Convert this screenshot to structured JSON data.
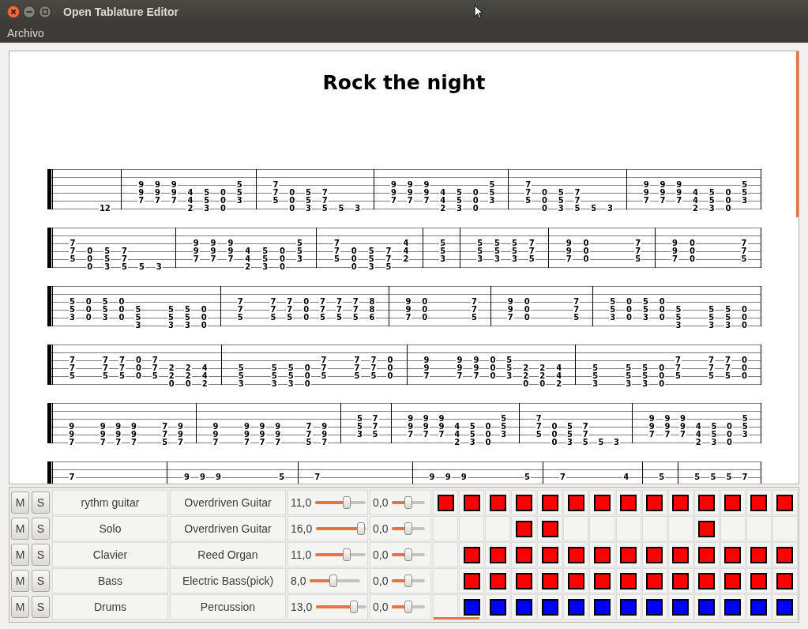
{
  "window": {
    "title": "Open Tablature Editor"
  },
  "menu": [
    {
      "label": "Archivo"
    }
  ],
  "score": {
    "title": "Rock the night",
    "systems": [
      {
        "measures": [
          {
            "beats": [
              {
                "kind": "blank"
              },
              {
                "kind": "blank"
              },
              {
                "kind": "notes",
                "string_6": "12"
              }
            ]
          },
          {
            "beats": [
              {
                "kind": "notes",
                "string_3": "9",
                "string_4": "9",
                "string_5": "7"
              },
              {
                "kind": "notes",
                "string_3": "9",
                "string_4": "9",
                "string_5": "7"
              },
              {
                "kind": "notes",
                "string_3": "9",
                "string_4": "9",
                "string_5": "7"
              },
              {
                "kind": "notes",
                "string_4": "4",
                "string_5": "4",
                "string_6": "2"
              },
              {
                "kind": "notes",
                "string_4": "5",
                "string_5": "5",
                "string_6": "3"
              },
              {
                "kind": "notes",
                "string_4": "0",
                "string_5": "0",
                "string_6": "0"
              },
              {
                "kind": "notes",
                "string_3": "5",
                "string_4": "5",
                "string_5": "3"
              }
            ]
          },
          {
            "beats": [
              {
                "kind": "notes",
                "string_3": "7",
                "string_4": "7",
                "string_5": "5"
              },
              {
                "kind": "notes",
                "string_4": "0",
                "string_5": "0",
                "string_6": "0"
              },
              {
                "kind": "notes",
                "string_4": "5",
                "string_5": "5",
                "string_6": "3"
              },
              {
                "kind": "notes",
                "string_4": "7",
                "string_5": "7",
                "string_6": "5"
              },
              {
                "kind": "notes",
                "string_6": "5"
              },
              {
                "kind": "notes",
                "string_6": "3"
              }
            ]
          },
          {
            "beats": [
              {
                "kind": "notes",
                "string_3": "9",
                "string_4": "9",
                "string_5": "7"
              },
              {
                "kind": "notes",
                "string_3": "9",
                "string_4": "9",
                "string_5": "7"
              },
              {
                "kind": "notes",
                "string_3": "9",
                "string_4": "9",
                "string_5": "7"
              },
              {
                "kind": "notes",
                "string_4": "4",
                "string_5": "4",
                "string_6": "2"
              },
              {
                "kind": "notes",
                "string_4": "5",
                "string_5": "5",
                "string_6": "3"
              },
              {
                "kind": "notes",
                "string_4": "0",
                "string_5": "0",
                "string_6": "0"
              },
              {
                "kind": "notes",
                "string_3": "5",
                "string_4": "5",
                "string_5": "3"
              }
            ]
          },
          {
            "beats": [
              {
                "kind": "notes",
                "string_3": "7",
                "string_4": "7",
                "string_5": "5"
              },
              {
                "kind": "notes",
                "string_4": "0",
                "string_5": "0",
                "string_6": "0"
              },
              {
                "kind": "notes",
                "string_4": "5",
                "string_5": "5",
                "string_6": "3"
              },
              {
                "kind": "notes",
                "string_4": "7",
                "string_5": "7",
                "string_6": "5"
              },
              {
                "kind": "notes",
                "string_6": "5"
              },
              {
                "kind": "notes",
                "string_6": "3"
              }
            ]
          },
          {
            "beats": [
              {
                "kind": "notes",
                "string_3": "9",
                "string_4": "9",
                "string_5": "7"
              },
              {
                "kind": "notes",
                "string_3": "9",
                "string_4": "9",
                "string_5": "7"
              },
              {
                "kind": "notes",
                "string_3": "9",
                "string_4": "9",
                "string_5": "7"
              },
              {
                "kind": "notes",
                "string_4": "4",
                "string_5": "4",
                "string_6": "2"
              },
              {
                "kind": "notes",
                "string_4": "5",
                "string_5": "5",
                "string_6": "3"
              },
              {
                "kind": "notes",
                "string_4": "0",
                "string_5": "0",
                "string_6": "0"
              },
              {
                "kind": "notes",
                "string_3": "5",
                "string_4": "5",
                "string_5": "3"
              }
            ]
          }
        ]
      },
      {
        "measures": [
          {
            "beats": [
              {
                "kind": "notes",
                "string_3": "7",
                "string_4": "7",
                "string_5": "5"
              },
              {
                "kind": "notes",
                "string_4": "0",
                "string_5": "0",
                "string_6": "0"
              },
              {
                "kind": "notes",
                "string_4": "5",
                "string_5": "5",
                "string_6": "3"
              },
              {
                "kind": "notes",
                "string_4": "7",
                "string_5": "7",
                "string_6": "5"
              },
              {
                "kind": "notes",
                "string_6": "5"
              },
              {
                "kind": "notes",
                "string_6": "3"
              }
            ]
          },
          {
            "beats": [
              {
                "kind": "notes",
                "string_3": "9",
                "string_4": "9",
                "string_5": "7"
              },
              {
                "kind": "notes",
                "string_3": "9",
                "string_4": "9",
                "string_5": "7"
              },
              {
                "kind": "notes",
                "string_3": "9",
                "string_4": "9",
                "string_5": "7"
              },
              {
                "kind": "notes",
                "string_4": "4",
                "string_5": "4",
                "string_6": "2"
              },
              {
                "kind": "notes",
                "string_4": "5",
                "string_5": "5",
                "string_6": "3"
              },
              {
                "kind": "notes",
                "string_4": "0",
                "string_5": "0",
                "string_6": "0"
              },
              {
                "kind": "notes",
                "string_3": "5",
                "string_4": "5",
                "string_5": "3"
              }
            ]
          },
          {
            "beats": [
              {
                "kind": "notes",
                "string_3": "7",
                "string_4": "7",
                "string_5": "5"
              },
              {
                "kind": "notes",
                "string_4": "0",
                "string_5": "0",
                "string_6": "0"
              },
              {
                "kind": "notes",
                "string_4": "5",
                "string_5": "5",
                "string_6": "3"
              },
              {
                "kind": "notes",
                "string_4": "7",
                "string_5": "7",
                "string_6": "5"
              },
              {
                "kind": "notes",
                "string_3": "4",
                "string_4": "4",
                "string_5": "2"
              }
            ]
          },
          {
            "beats": [
              {
                "kind": "notes",
                "string_3": "5",
                "string_4": "5",
                "string_5": "3"
              }
            ]
          },
          {
            "beats": [
              {
                "kind": "notes",
                "string_3": "5",
                "string_4": "5",
                "string_5": "3"
              },
              {
                "kind": "notes",
                "string_3": "5",
                "string_4": "5",
                "string_5": "3"
              },
              {
                "kind": "notes",
                "string_3": "5",
                "string_4": "5",
                "string_5": "3"
              },
              {
                "kind": "notes",
                "string_3": "7",
                "string_4": "7",
                "string_5": "5"
              }
            ]
          },
          {
            "beats": [
              {
                "kind": "notes",
                "string_3": "9",
                "string_4": "9",
                "string_5": "7"
              },
              {
                "kind": "notes",
                "string_3": "0",
                "string_4": "0",
                "string_5": "0"
              },
              {
                "kind": "blank"
              },
              {
                "kind": "blank"
              },
              {
                "kind": "notes",
                "string_3": "7",
                "string_4": "7",
                "string_5": "5"
              }
            ]
          },
          {
            "beats": [
              {
                "kind": "notes",
                "string_3": "9",
                "string_4": "9",
                "string_5": "7"
              },
              {
                "kind": "notes",
                "string_3": "0",
                "string_4": "0",
                "string_5": "0"
              },
              {
                "kind": "blank"
              },
              {
                "kind": "blank"
              },
              {
                "kind": "notes",
                "string_3": "7",
                "string_4": "7",
                "string_5": "5"
              }
            ]
          }
        ]
      },
      {
        "measures": [
          {
            "beats": [
              {
                "kind": "notes",
                "string_3": "5",
                "string_4": "5",
                "string_5": "3"
              },
              {
                "kind": "notes",
                "string_3": "0",
                "string_4": "0",
                "string_5": "0"
              },
              {
                "kind": "notes",
                "string_3": "5",
                "string_4": "5",
                "string_5": "3"
              },
              {
                "kind": "notes",
                "string_3": "0",
                "string_4": "0",
                "string_5": "0"
              },
              {
                "kind": "notes",
                "string_4": "5",
                "string_5": "5",
                "string_6": "3"
              },
              {
                "kind": "blank"
              },
              {
                "kind": "notes",
                "string_4": "5",
                "string_5": "5",
                "string_6": "3"
              },
              {
                "kind": "notes",
                "string_4": "5",
                "string_5": "5",
                "string_6": "3"
              },
              {
                "kind": "notes",
                "string_4": "0",
                "string_5": "0",
                "string_6": "0"
              }
            ]
          },
          {
            "beats": [
              {
                "kind": "notes",
                "string_3": "7",
                "string_4": "7",
                "string_5": "5"
              },
              {
                "kind": "blank"
              },
              {
                "kind": "notes",
                "string_3": "7",
                "string_4": "7",
                "string_5": "5"
              },
              {
                "kind": "notes",
                "string_3": "7",
                "string_4": "7",
                "string_5": "5"
              },
              {
                "kind": "notes",
                "string_3": "0",
                "string_4": "0",
                "string_5": "0"
              },
              {
                "kind": "notes",
                "string_3": "7",
                "string_4": "7",
                "string_5": "5"
              },
              {
                "kind": "notes",
                "string_3": "7",
                "string_4": "7",
                "string_5": "5"
              },
              {
                "kind": "notes",
                "string_3": "7",
                "string_4": "7",
                "string_5": "5"
              },
              {
                "kind": "notes",
                "string_3": "8",
                "string_4": "8",
                "string_5": "6"
              }
            ]
          },
          {
            "beats": [
              {
                "kind": "notes",
                "string_3": "9",
                "string_4": "9",
                "string_5": "7"
              },
              {
                "kind": "notes",
                "string_3": "0",
                "string_4": "0",
                "string_5": "0"
              },
              {
                "kind": "blank"
              },
              {
                "kind": "blank"
              },
              {
                "kind": "notes",
                "string_3": "7",
                "string_4": "7",
                "string_5": "5"
              }
            ]
          },
          {
            "beats": [
              {
                "kind": "notes",
                "string_3": "9",
                "string_4": "9",
                "string_5": "7"
              },
              {
                "kind": "notes",
                "string_3": "0",
                "string_4": "0",
                "string_5": "0"
              },
              {
                "kind": "blank"
              },
              {
                "kind": "blank"
              },
              {
                "kind": "notes",
                "string_3": "7",
                "string_4": "7",
                "string_5": "5"
              }
            ]
          },
          {
            "beats": [
              {
                "kind": "notes",
                "string_3": "5",
                "string_4": "5",
                "string_5": "3"
              },
              {
                "kind": "notes",
                "string_3": "0",
                "string_4": "0",
                "string_5": "0"
              },
              {
                "kind": "notes",
                "string_3": "5",
                "string_4": "5",
                "string_5": "3"
              },
              {
                "kind": "notes",
                "string_3": "0",
                "string_4": "0",
                "string_5": "0"
              },
              {
                "kind": "notes",
                "string_4": "5",
                "string_5": "5",
                "string_6": "3"
              },
              {
                "kind": "blank"
              },
              {
                "kind": "notes",
                "string_4": "5",
                "string_5": "5",
                "string_6": "3"
              },
              {
                "kind": "notes",
                "string_4": "5",
                "string_5": "5",
                "string_6": "3"
              },
              {
                "kind": "notes",
                "string_4": "0",
                "string_5": "0",
                "string_6": "0"
              }
            ]
          }
        ]
      },
      {
        "measures": [
          {
            "beats": [
              {
                "kind": "notes",
                "string_3": "7",
                "string_4": "7",
                "string_5": "5"
              },
              {
                "kind": "blank"
              },
              {
                "kind": "notes",
                "string_3": "7",
                "string_4": "7",
                "string_5": "5"
              },
              {
                "kind": "notes",
                "string_3": "7",
                "string_4": "7",
                "string_5": "5"
              },
              {
                "kind": "notes",
                "string_3": "0",
                "string_4": "0",
                "string_5": "0"
              },
              {
                "kind": "notes",
                "string_3": "7",
                "string_4": "7",
                "string_5": "5"
              },
              {
                "kind": "notes",
                "string_4": "2",
                "string_5": "2",
                "string_6": "0"
              },
              {
                "kind": "notes",
                "string_4": "2",
                "string_5": "2",
                "string_6": "0"
              },
              {
                "kind": "notes",
                "string_4": "4",
                "string_5": "4",
                "string_6": "2"
              }
            ]
          },
          {
            "beats": [
              {
                "kind": "notes",
                "string_4": "5",
                "string_5": "5",
                "string_6": "3"
              },
              {
                "kind": "blank"
              },
              {
                "kind": "notes",
                "string_4": "5",
                "string_5": "5",
                "string_6": "3"
              },
              {
                "kind": "notes",
                "string_4": "5",
                "string_5": "5",
                "string_6": "3"
              },
              {
                "kind": "notes",
                "string_4": "0",
                "string_5": "0",
                "string_6": "0"
              },
              {
                "kind": "notes",
                "string_3": "7",
                "string_4": "7",
                "string_5": "5"
              },
              {
                "kind": "blank"
              },
              {
                "kind": "notes",
                "string_3": "7",
                "string_4": "7",
                "string_5": "5"
              },
              {
                "kind": "notes",
                "string_3": "7",
                "string_4": "7",
                "string_5": "5"
              },
              {
                "kind": "notes",
                "string_3": "0",
                "string_4": "0",
                "string_5": "0"
              }
            ]
          },
          {
            "beats": [
              {
                "kind": "notes",
                "string_3": "9",
                "string_4": "9",
                "string_5": "7"
              },
              {
                "kind": "blank"
              },
              {
                "kind": "notes",
                "string_3": "9",
                "string_4": "9",
                "string_5": "7"
              },
              {
                "kind": "notes",
                "string_3": "9",
                "string_4": "9",
                "string_5": "7"
              },
              {
                "kind": "notes",
                "string_3": "0",
                "string_4": "0",
                "string_5": "0"
              },
              {
                "kind": "notes",
                "string_3": "5",
                "string_4": "5",
                "string_5": "3"
              },
              {
                "kind": "notes",
                "string_4": "2",
                "string_5": "2",
                "string_6": "0"
              },
              {
                "kind": "notes",
                "string_4": "2",
                "string_5": "2",
                "string_6": "0"
              },
              {
                "kind": "notes",
                "string_4": "4",
                "string_5": "4",
                "string_6": "2"
              }
            ]
          },
          {
            "beats": [
              {
                "kind": "notes",
                "string_4": "5",
                "string_5": "5",
                "string_6": "3"
              },
              {
                "kind": "blank"
              },
              {
                "kind": "notes",
                "string_4": "5",
                "string_5": "5",
                "string_6": "3"
              },
              {
                "kind": "notes",
                "string_4": "5",
                "string_5": "5",
                "string_6": "3"
              },
              {
                "kind": "notes",
                "string_4": "0",
                "string_5": "0",
                "string_6": "0"
              },
              {
                "kind": "notes",
                "string_3": "7",
                "string_4": "7",
                "string_5": "5"
              },
              {
                "kind": "blank"
              },
              {
                "kind": "notes",
                "string_3": "7",
                "string_4": "7",
                "string_5": "5"
              },
              {
                "kind": "notes",
                "string_3": "7",
                "string_4": "7",
                "string_5": "5"
              },
              {
                "kind": "notes",
                "string_3": "0",
                "string_4": "0",
                "string_5": "0"
              }
            ]
          }
        ]
      },
      {
        "measures": [
          {
            "beats": [
              {
                "kind": "notes",
                "string_4": "9",
                "string_5": "9",
                "string_6": "7"
              },
              {
                "kind": "blank"
              },
              {
                "kind": "notes",
                "string_4": "9",
                "string_5": "9",
                "string_6": "7"
              },
              {
                "kind": "notes",
                "string_4": "9",
                "string_5": "9",
                "string_6": "7"
              },
              {
                "kind": "notes",
                "string_4": "9",
                "string_5": "9",
                "string_6": "7"
              },
              {
                "kind": "blank"
              },
              {
                "kind": "notes",
                "string_4": "7",
                "string_5": "7",
                "string_6": "5"
              },
              {
                "kind": "notes",
                "string_4": "9",
                "string_5": "9",
                "string_6": "7"
              }
            ]
          },
          {
            "beats": [
              {
                "kind": "notes",
                "string_4": "9",
                "string_5": "9",
                "string_6": "7"
              },
              {
                "kind": "blank"
              },
              {
                "kind": "notes",
                "string_4": "9",
                "string_5": "9",
                "string_6": "7"
              },
              {
                "kind": "notes",
                "string_4": "9",
                "string_5": "9",
                "string_6": "7"
              },
              {
                "kind": "notes",
                "string_4": "9",
                "string_5": "9",
                "string_6": "7"
              },
              {
                "kind": "blank"
              },
              {
                "kind": "notes",
                "string_4": "7",
                "string_5": "7",
                "string_6": "5"
              },
              {
                "kind": "notes",
                "string_4": "9",
                "string_5": "9",
                "string_6": "7"
              }
            ]
          },
          {
            "beats": [
              {
                "kind": "notes",
                "string_3": "5",
                "string_4": "5",
                "string_5": "3"
              },
              {
                "kind": "notes",
                "string_3": "7",
                "string_4": "7",
                "string_5": "5"
              }
            ]
          },
          {
            "beats": [
              {
                "kind": "notes",
                "string_3": "9",
                "string_4": "9",
                "string_5": "7"
              },
              {
                "kind": "notes",
                "string_3": "9",
                "string_4": "9",
                "string_5": "7"
              },
              {
                "kind": "notes",
                "string_3": "9",
                "string_4": "9",
                "string_5": "7"
              },
              {
                "kind": "notes",
                "string_4": "4",
                "string_5": "4",
                "string_6": "2"
              },
              {
                "kind": "notes",
                "string_4": "5",
                "string_5": "5",
                "string_6": "3"
              },
              {
                "kind": "notes",
                "string_4": "0",
                "string_5": "0",
                "string_6": "0"
              },
              {
                "kind": "notes",
                "string_3": "5",
                "string_4": "5",
                "string_5": "3"
              }
            ]
          },
          {
            "beats": [
              {
                "kind": "notes",
                "string_3": "7",
                "string_4": "7",
                "string_5": "5"
              },
              {
                "kind": "notes",
                "string_4": "0",
                "string_5": "0",
                "string_6": "0"
              },
              {
                "kind": "notes",
                "string_4": "5",
                "string_5": "5",
                "string_6": "3"
              },
              {
                "kind": "notes",
                "string_4": "7",
                "string_5": "7",
                "string_6": "5"
              },
              {
                "kind": "notes",
                "string_6": "5"
              },
              {
                "kind": "notes",
                "string_6": "3"
              }
            ]
          },
          {
            "beats": [
              {
                "kind": "notes",
                "string_3": "9",
                "string_4": "9",
                "string_5": "7"
              },
              {
                "kind": "notes",
                "string_3": "9",
                "string_4": "9",
                "string_5": "7"
              },
              {
                "kind": "notes",
                "string_3": "9",
                "string_4": "9",
                "string_5": "7"
              },
              {
                "kind": "notes",
                "string_4": "4",
                "string_5": "4",
                "string_6": "2"
              },
              {
                "kind": "notes",
                "string_4": "5",
                "string_5": "5",
                "string_6": "3"
              },
              {
                "kind": "notes",
                "string_4": "0",
                "string_5": "0",
                "string_6": "0"
              },
              {
                "kind": "notes",
                "string_3": "5",
                "string_4": "5",
                "string_5": "3"
              }
            ]
          }
        ]
      },
      {
        "measures": [
          {
            "beats": [
              {
                "kind": "notes",
                "string_3": "7"
              },
              {
                "kind": "blank"
              },
              {
                "kind": "blank"
              },
              {
                "kind": "blank"
              },
              {
                "kind": "blank"
              },
              {
                "kind": "blank"
              }
            ]
          },
          {
            "beats": [
              {
                "kind": "notes",
                "string_3": "9"
              },
              {
                "kind": "notes",
                "string_3": "9"
              },
              {
                "kind": "notes",
                "string_3": "9"
              },
              {
                "kind": "blank"
              },
              {
                "kind": "blank"
              },
              {
                "kind": "blank"
              },
              {
                "kind": "notes",
                "string_3": "5"
              }
            ]
          },
          {
            "beats": [
              {
                "kind": "notes",
                "string_3": "7"
              },
              {
                "kind": "blank"
              },
              {
                "kind": "blank"
              },
              {
                "kind": "blank"
              },
              {
                "kind": "blank"
              },
              {
                "kind": "blank"
              }
            ]
          },
          {
            "beats": [
              {
                "kind": "notes",
                "string_3": "9"
              },
              {
                "kind": "notes",
                "string_3": "9"
              },
              {
                "kind": "notes",
                "string_3": "9"
              },
              {
                "kind": "blank"
              },
              {
                "kind": "blank"
              },
              {
                "kind": "blank"
              },
              {
                "kind": "notes",
                "string_3": "5"
              }
            ]
          },
          {
            "beats": [
              {
                "kind": "notes",
                "string_3": "7"
              },
              {
                "kind": "blank"
              },
              {
                "kind": "blank"
              },
              {
                "kind": "blank"
              },
              {
                "kind": "notes",
                "string_3": "4"
              }
            ]
          },
          {
            "beats": [
              {
                "kind": "notes",
                "string_3": "5"
              }
            ]
          },
          {
            "beats": [
              {
                "kind": "notes",
                "string_3": "5"
              },
              {
                "kind": "notes",
                "string_3": "5"
              },
              {
                "kind": "notes",
                "string_3": "5"
              },
              {
                "kind": "notes",
                "string_3": "7"
              }
            ]
          }
        ]
      }
    ]
  },
  "tracks": [
    {
      "mute": "M",
      "solo": "S",
      "name": "rythm guitar",
      "instrument": "Overdriven Guitar",
      "volume": {
        "reading": "11,0",
        "level": 0.65
      },
      "balance": {
        "reading": "0,0",
        "level": 0.5
      },
      "color": "#ff0000",
      "blocks": [
        true,
        true,
        true,
        true,
        true,
        true,
        true,
        true,
        true,
        true,
        true,
        true,
        true,
        true
      ]
    },
    {
      "mute": "M",
      "solo": "S",
      "name": "Solo",
      "instrument": "Overdriven Guitar",
      "volume": {
        "reading": "16,0",
        "level": 0.96
      },
      "balance": {
        "reading": "0,0",
        "level": 0.5
      },
      "color": "#ff0000",
      "blocks": [
        false,
        false,
        false,
        true,
        true,
        false,
        false,
        false,
        false,
        false,
        true,
        false,
        false,
        false
      ]
    },
    {
      "mute": "M",
      "solo": "S",
      "name": "Clavier",
      "instrument": "Reed Organ",
      "volume": {
        "reading": "11,0",
        "level": 0.65
      },
      "balance": {
        "reading": "0,0",
        "level": 0.5
      },
      "color": "#ff0000",
      "blocks": [
        false,
        true,
        true,
        true,
        true,
        true,
        true,
        true,
        true,
        true,
        true,
        true,
        true,
        true
      ]
    },
    {
      "mute": "M",
      "solo": "S",
      "name": "Bass",
      "instrument": "Electric Bass(pick)",
      "volume": {
        "reading": "8,0",
        "level": 0.46
      },
      "balance": {
        "reading": "0,0",
        "level": 0.5
      },
      "color": "#ff0000",
      "blocks": [
        false,
        true,
        true,
        true,
        true,
        true,
        true,
        true,
        true,
        true,
        true,
        true,
        true,
        true
      ]
    },
    {
      "mute": "M",
      "solo": "S",
      "name": "Drums",
      "instrument": "Percussion",
      "volume": {
        "reading": "13,0",
        "level": 0.8
      },
      "balance": {
        "reading": "0,0",
        "level": 0.5
      },
      "color": "#0000ff",
      "blocks": [
        false,
        true,
        true,
        true,
        true,
        true,
        true,
        true,
        true,
        true,
        true,
        true,
        true,
        true
      ]
    }
  ]
}
